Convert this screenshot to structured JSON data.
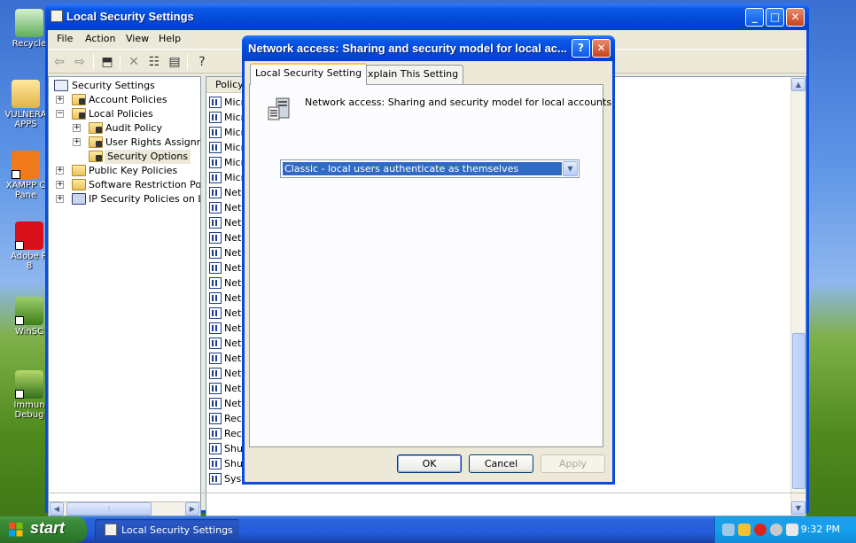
{
  "desktop": {
    "icons": [
      {
        "label": "Recycle"
      },
      {
        "label": "VULNERA\nAPPS"
      },
      {
        "label": "XAMPP C\nPane"
      },
      {
        "label": "Adobe R\n8"
      },
      {
        "label": "WinSC"
      },
      {
        "label": "Immun\nDebug"
      }
    ]
  },
  "main_window": {
    "title": "Local Security Settings",
    "menu": [
      "File",
      "Action",
      "View",
      "Help"
    ],
    "tree": [
      {
        "label": "Security Settings",
        "level": 0,
        "expander": "−"
      },
      {
        "label": "Account Policies",
        "level": 1,
        "expander": "+"
      },
      {
        "label": "Local Policies",
        "level": 1,
        "expander": "−"
      },
      {
        "label": "Audit Policy",
        "level": 2,
        "expander": "+"
      },
      {
        "label": "User Rights Assignmen",
        "level": 2,
        "expander": "+"
      },
      {
        "label": "Security Options",
        "level": 2,
        "expander": ""
      },
      {
        "label": "Public Key Policies",
        "level": 1,
        "expander": "+"
      },
      {
        "label": "Software Restriction Polici",
        "level": 1,
        "expander": "+"
      },
      {
        "label": "IP Security Policies on Loca",
        "level": 1,
        "expander": "+"
      }
    ],
    "list_header": "Policy",
    "list_rows": [
      "Micro",
      "Micro",
      "Micro",
      "Micro",
      "Micro",
      "Micro",
      "Netw",
      "Netw",
      "Netw",
      "Netw",
      "Netw",
      "Netw",
      "Netw",
      "Netw",
      "Netw",
      "Netw",
      "Netw",
      "Netw",
      "Netw",
      "Netw",
      "Netw",
      "Reco",
      "Reco",
      "Shut",
      "Shut",
      "Syst"
    ]
  },
  "dialog": {
    "title": "Network access: Sharing and security model for local ac...",
    "help_button": "?",
    "close_button": "✕",
    "tabs": [
      "Local Security Setting",
      "Explain This Setting"
    ],
    "policy_name": "Network access: Sharing and security model for local accounts",
    "selected_value": "Classic - local users authenticate as themselves",
    "buttons": {
      "ok": "OK",
      "cancel": "Cancel",
      "apply": "Apply"
    }
  },
  "taskbar": {
    "start_label": "start",
    "task_label": "Local Security Settings",
    "clock": "9:32 PM"
  },
  "colors": {
    "xp_blue": "#0a4adf",
    "selection": "#316ac5",
    "start_green": "#3c8c3a",
    "tray_blue": "#14a0ee"
  }
}
